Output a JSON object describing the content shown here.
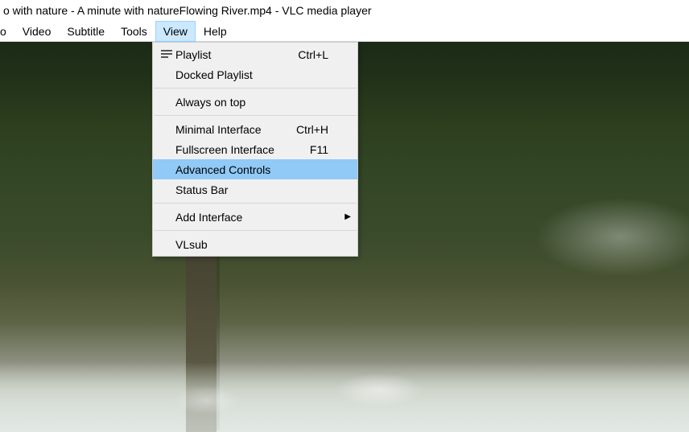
{
  "title": "o with nature - A minute with natureFlowing River.mp4 - VLC media player",
  "menubar": {
    "items": [
      {
        "label": "o"
      },
      {
        "label": "Video"
      },
      {
        "label": "Subtitle"
      },
      {
        "label": "Tools"
      },
      {
        "label": "View",
        "active": true
      },
      {
        "label": "Help"
      }
    ]
  },
  "view_menu": {
    "playlist": {
      "label": "Playlist",
      "shortcut": "Ctrl+L"
    },
    "docked_playlist": {
      "label": "Docked Playlist"
    },
    "always_on_top": {
      "label": "Always on top"
    },
    "minimal_interface": {
      "label": "Minimal Interface",
      "shortcut": "Ctrl+H"
    },
    "fullscreen_interface": {
      "label": "Fullscreen Interface",
      "shortcut": "F11"
    },
    "advanced_controls": {
      "label": "Advanced Controls"
    },
    "status_bar": {
      "label": "Status Bar"
    },
    "add_interface": {
      "label": "Add Interface"
    },
    "vlsub": {
      "label": "VLsub"
    }
  }
}
